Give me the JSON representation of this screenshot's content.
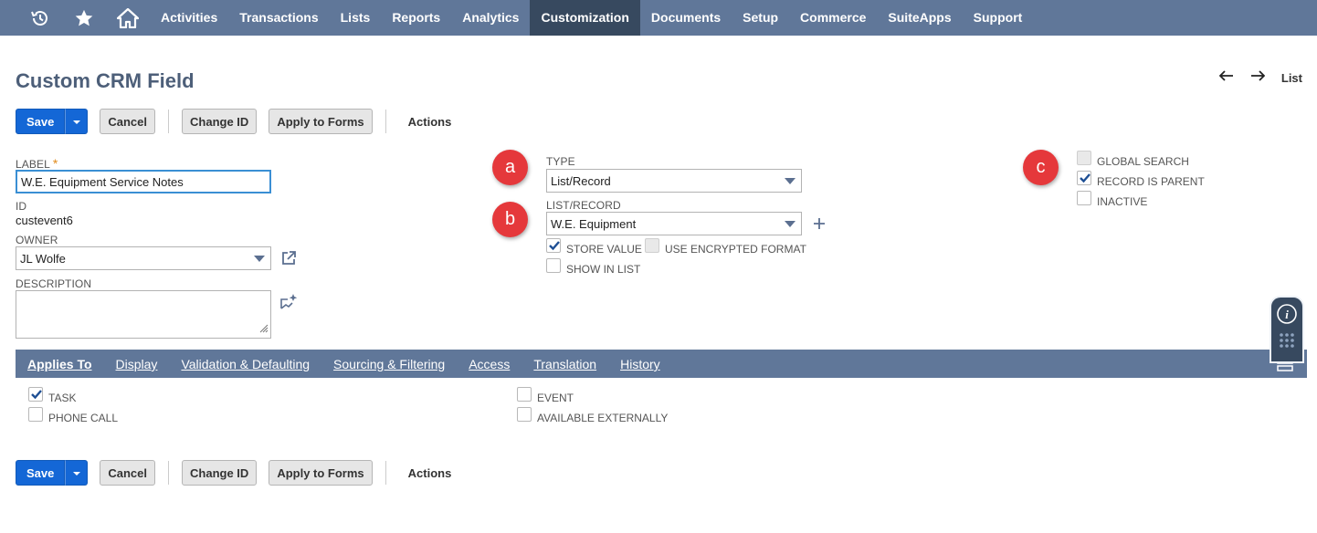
{
  "nav": {
    "icons": [
      "recent-history-icon",
      "star-icon",
      "home-icon"
    ],
    "items": [
      "Activities",
      "Transactions",
      "Lists",
      "Reports",
      "Analytics",
      "Customization",
      "Documents",
      "Setup",
      "Commerce",
      "SuiteApps",
      "Support"
    ],
    "active": "Customization"
  },
  "page": {
    "title": "Custom CRM Field",
    "list_link": "List"
  },
  "buttons": {
    "save": "Save",
    "cancel": "Cancel",
    "change_id": "Change ID",
    "apply_to_forms": "Apply to Forms",
    "actions": "Actions"
  },
  "fields": {
    "label": {
      "label": "LABEL",
      "required_mark": "*",
      "value": "W.E. Equipment Service Notes"
    },
    "id": {
      "label": "ID",
      "value": "custevent6"
    },
    "owner": {
      "label": "OWNER",
      "value": "JL Wolfe"
    },
    "description": {
      "label": "DESCRIPTION",
      "value": ""
    },
    "type": {
      "label": "TYPE",
      "value": "List/Record"
    },
    "list_record": {
      "label": "LIST/RECORD",
      "value": "W.E. Equipment"
    }
  },
  "checkboxes": {
    "store_value": {
      "label": "STORE VALUE",
      "checked": true
    },
    "use_encrypted_format": {
      "label": "USE ENCRYPTED FORMAT",
      "checked": false,
      "disabled": true
    },
    "show_in_list": {
      "label": "SHOW IN LIST",
      "checked": false
    },
    "global_search": {
      "label": "GLOBAL SEARCH",
      "checked": false,
      "disabled": true
    },
    "record_is_parent": {
      "label": "RECORD IS PARENT",
      "checked": true
    },
    "inactive": {
      "label": "INACTIVE",
      "checked": false
    }
  },
  "badges": {
    "a": "a",
    "b": "b",
    "c": "c"
  },
  "subtabs": [
    "Applies To",
    "Display",
    "Validation & Defaulting",
    "Sourcing & Filtering",
    "Access",
    "Translation",
    "History"
  ],
  "applies_to": {
    "task": {
      "label": "TASK",
      "checked": true
    },
    "phone_call": {
      "label": "PHONE CALL",
      "checked": false
    },
    "event": {
      "label": "EVENT",
      "checked": false
    },
    "available_externally": {
      "label": "AVAILABLE EXTERNALLY",
      "checked": false
    }
  },
  "colors": {
    "nav_bg": "#607799",
    "nav_active": "#37495f",
    "primary_button": "#1467d6",
    "badge": "#e5383b",
    "title": "#4d5f79"
  }
}
